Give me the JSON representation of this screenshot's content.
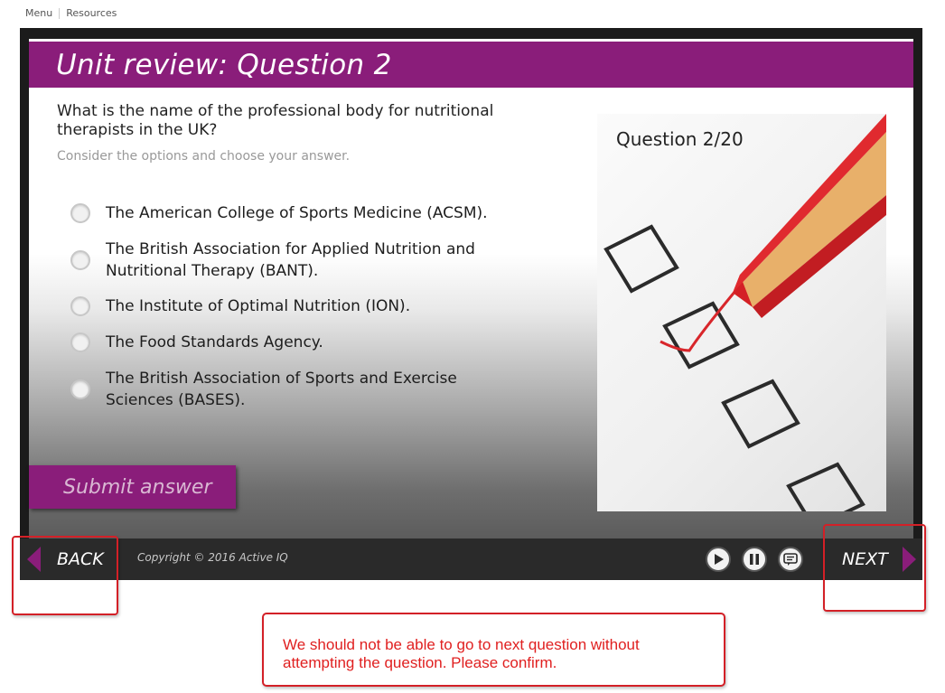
{
  "top_nav": {
    "menu": "Menu",
    "resources": "Resources"
  },
  "slide": {
    "title": "Unit review: Question 2",
    "question": "What is the name of the professional body for nutritional therapists in the UK?",
    "instruction": "Consider the options and choose your answer.",
    "options": [
      {
        "label": "The American College of Sports Medicine (ACSM)."
      },
      {
        "label": "The British Association for Applied Nutrition and Nutritional Therapy (BANT)."
      },
      {
        "label": "The Institute of Optimal Nutrition (ION)."
      },
      {
        "label": "The Food Standards Agency."
      },
      {
        "label": "The British Association of Sports and Exercise Sciences (BASES)."
      }
    ],
    "submit_label": "Submit answer",
    "question_counter": "Question 2/20"
  },
  "player": {
    "back_label": "BACK",
    "next_label": "NEXT",
    "copyright": "Copyright © 2016 Active IQ",
    "controls": [
      "play-icon",
      "pause-icon",
      "captions-icon"
    ]
  },
  "annotation": {
    "note_line1": "We should not be able to go to next question without",
    "note_line2": "attempting the question. Please confirm."
  },
  "colors": {
    "accent": "#8a1d7a",
    "annotation": "#d32027"
  }
}
